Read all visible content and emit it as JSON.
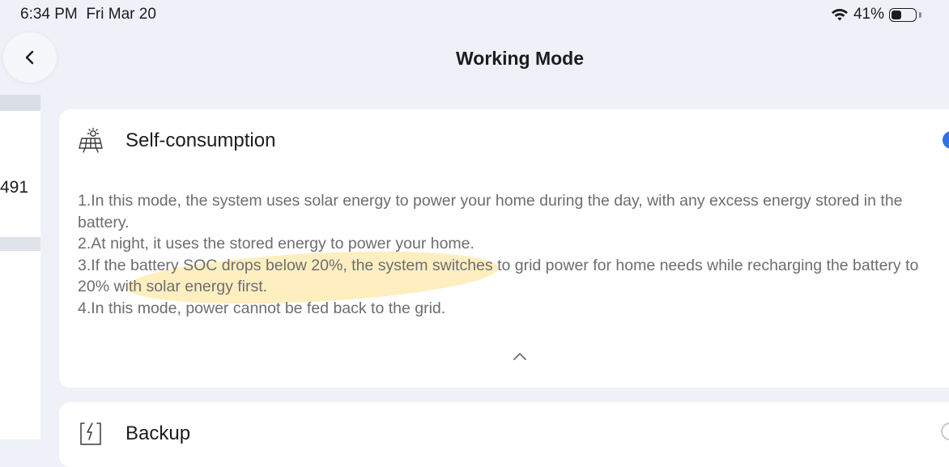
{
  "status": {
    "time": "6:34 PM",
    "date": "Fri Mar 20",
    "battery": "41%",
    "battery_level": 0.41
  },
  "header": {
    "title": "Working Mode"
  },
  "side": {
    "value": "491"
  },
  "modes": [
    {
      "title": "Self-consumption",
      "icon": "solar-panel-icon",
      "selected": true,
      "expanded": true,
      "description": [
        "1.In this mode, the system uses solar energy to power your home during the day, with any excess energy stored in the battery.",
        "2.At night, it uses the stored energy to power your home.",
        "3.If the battery SOC drops below 20%, the system switches to grid power for home needs while recharging the battery to 20% with solar energy first.",
        "4.In this mode, power cannot be fed back to the grid."
      ]
    },
    {
      "title": "Backup",
      "icon": "battery-bolt-icon",
      "selected": false
    }
  ],
  "colors": {
    "accent": "#2f72e4",
    "background": "#eef2f8",
    "highlight": "#ffd65a"
  }
}
